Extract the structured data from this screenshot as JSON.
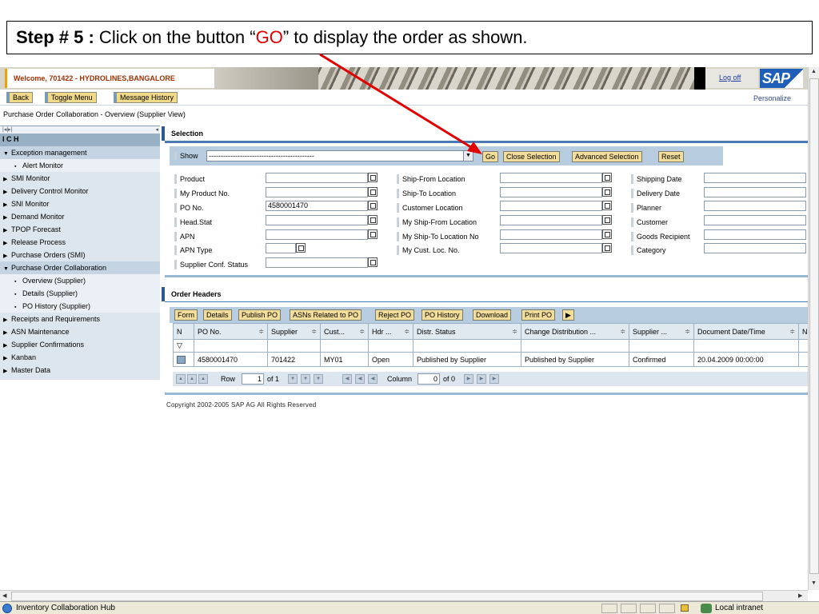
{
  "banner": {
    "step": "Step # 5 :",
    "before": " Click on the button “",
    "go": "GO",
    "after": "” to display the order as shown."
  },
  "header": {
    "welcome": "Welcome, 701422 - HYDROLINES,BANGALORE",
    "logoff": "Log off",
    "logo": "SAP",
    "personalize": "Personalize"
  },
  "toolbar": {
    "back": "Back",
    "toggle": "Toggle Menu",
    "history": "Message History"
  },
  "breadcrumb": "Purchase Order Collaboration - Overview (Supplier View)",
  "nav": {
    "top_controls": "|◂|▸|",
    "title": "I C H",
    "items": [
      {
        "label": "Exception management",
        "marker": "▼"
      },
      {
        "label": "Alert Monitor",
        "marker": "▪"
      },
      {
        "label": "SMI Monitor",
        "marker": "▶"
      },
      {
        "label": "Delivery Control Monitor",
        "marker": "▶"
      },
      {
        "label": "SNI Monitor",
        "marker": "▶"
      },
      {
        "label": "Demand Monitor",
        "marker": "▶"
      },
      {
        "label": "TPOP Forecast",
        "marker": "▶"
      },
      {
        "label": "Release Process",
        "marker": "▶"
      },
      {
        "label": "Purchase Orders (SMI)",
        "marker": "▶"
      },
      {
        "label": "Purchase Order Collaboration",
        "marker": "▼"
      },
      {
        "label": "Overview (Supplier)",
        "marker": "▪"
      },
      {
        "label": "Details (Supplier)",
        "marker": "▪"
      },
      {
        "label": "PO History (Supplier)",
        "marker": "▪"
      },
      {
        "label": "Receipts and Requirements",
        "marker": "▶"
      },
      {
        "label": "ASN Maintenance",
        "marker": "▶"
      },
      {
        "label": "Supplier Confirmations",
        "marker": "▶"
      },
      {
        "label": "Kanban",
        "marker": "▶"
      },
      {
        "label": "Master Data",
        "marker": "▶"
      }
    ]
  },
  "selection": {
    "title": "Selection",
    "show_label": "Show",
    "show_value": "--------------------------------------------",
    "buttons": {
      "go": "Go",
      "close": "Close Selection",
      "advanced": "Advanced Selection",
      "reset": "Reset"
    },
    "col1": [
      "Product",
      "My Product No.",
      "PO No.",
      "Head.Stat",
      "APN",
      "APN Type",
      "Supplier Conf. Status"
    ],
    "col2": [
      "Ship-From Location",
      "Ship-To Location",
      "Customer Location",
      "My Ship-From Location",
      "My Ship-To Location No",
      "My Cust. Loc. No."
    ],
    "col3": [
      "Shipping Date",
      "Delivery Date",
      "Planner",
      "Customer",
      "Goods Recipient",
      "Category"
    ],
    "po_value": "4580001470"
  },
  "orders": {
    "title": "Order Headers",
    "buttons": [
      "Form",
      "Details",
      "Publish PO",
      "ASNs Related to PO",
      "Reject PO",
      "PO History",
      "Download",
      "Print PO"
    ],
    "more": "▶",
    "filter_icon": "▽",
    "columns": [
      "N",
      "PO No.",
      "Supplier",
      "Cust...",
      "Hdr ...",
      "Distr. Status",
      "Change Distribution ...",
      "Supplier ...",
      "Document Date/Time",
      "N"
    ],
    "row": [
      "",
      "4580001470",
      "701422",
      "MY01",
      "Open",
      "Published by Supplier",
      "Published by Supplier",
      "Confirmed",
      "20.04.2009 00:00:00",
      ""
    ],
    "pager": {
      "row_label": "Row",
      "row_value": "1",
      "row_of": "of 1",
      "col_label": "Column",
      "col_value": "0",
      "col_of": "of 0"
    }
  },
  "copyright": "Copyright 2002-2005 SAP AG All Rights Reserved",
  "status": {
    "text": "Inventory Collaboration Hub",
    "zone": "Local intranet"
  }
}
